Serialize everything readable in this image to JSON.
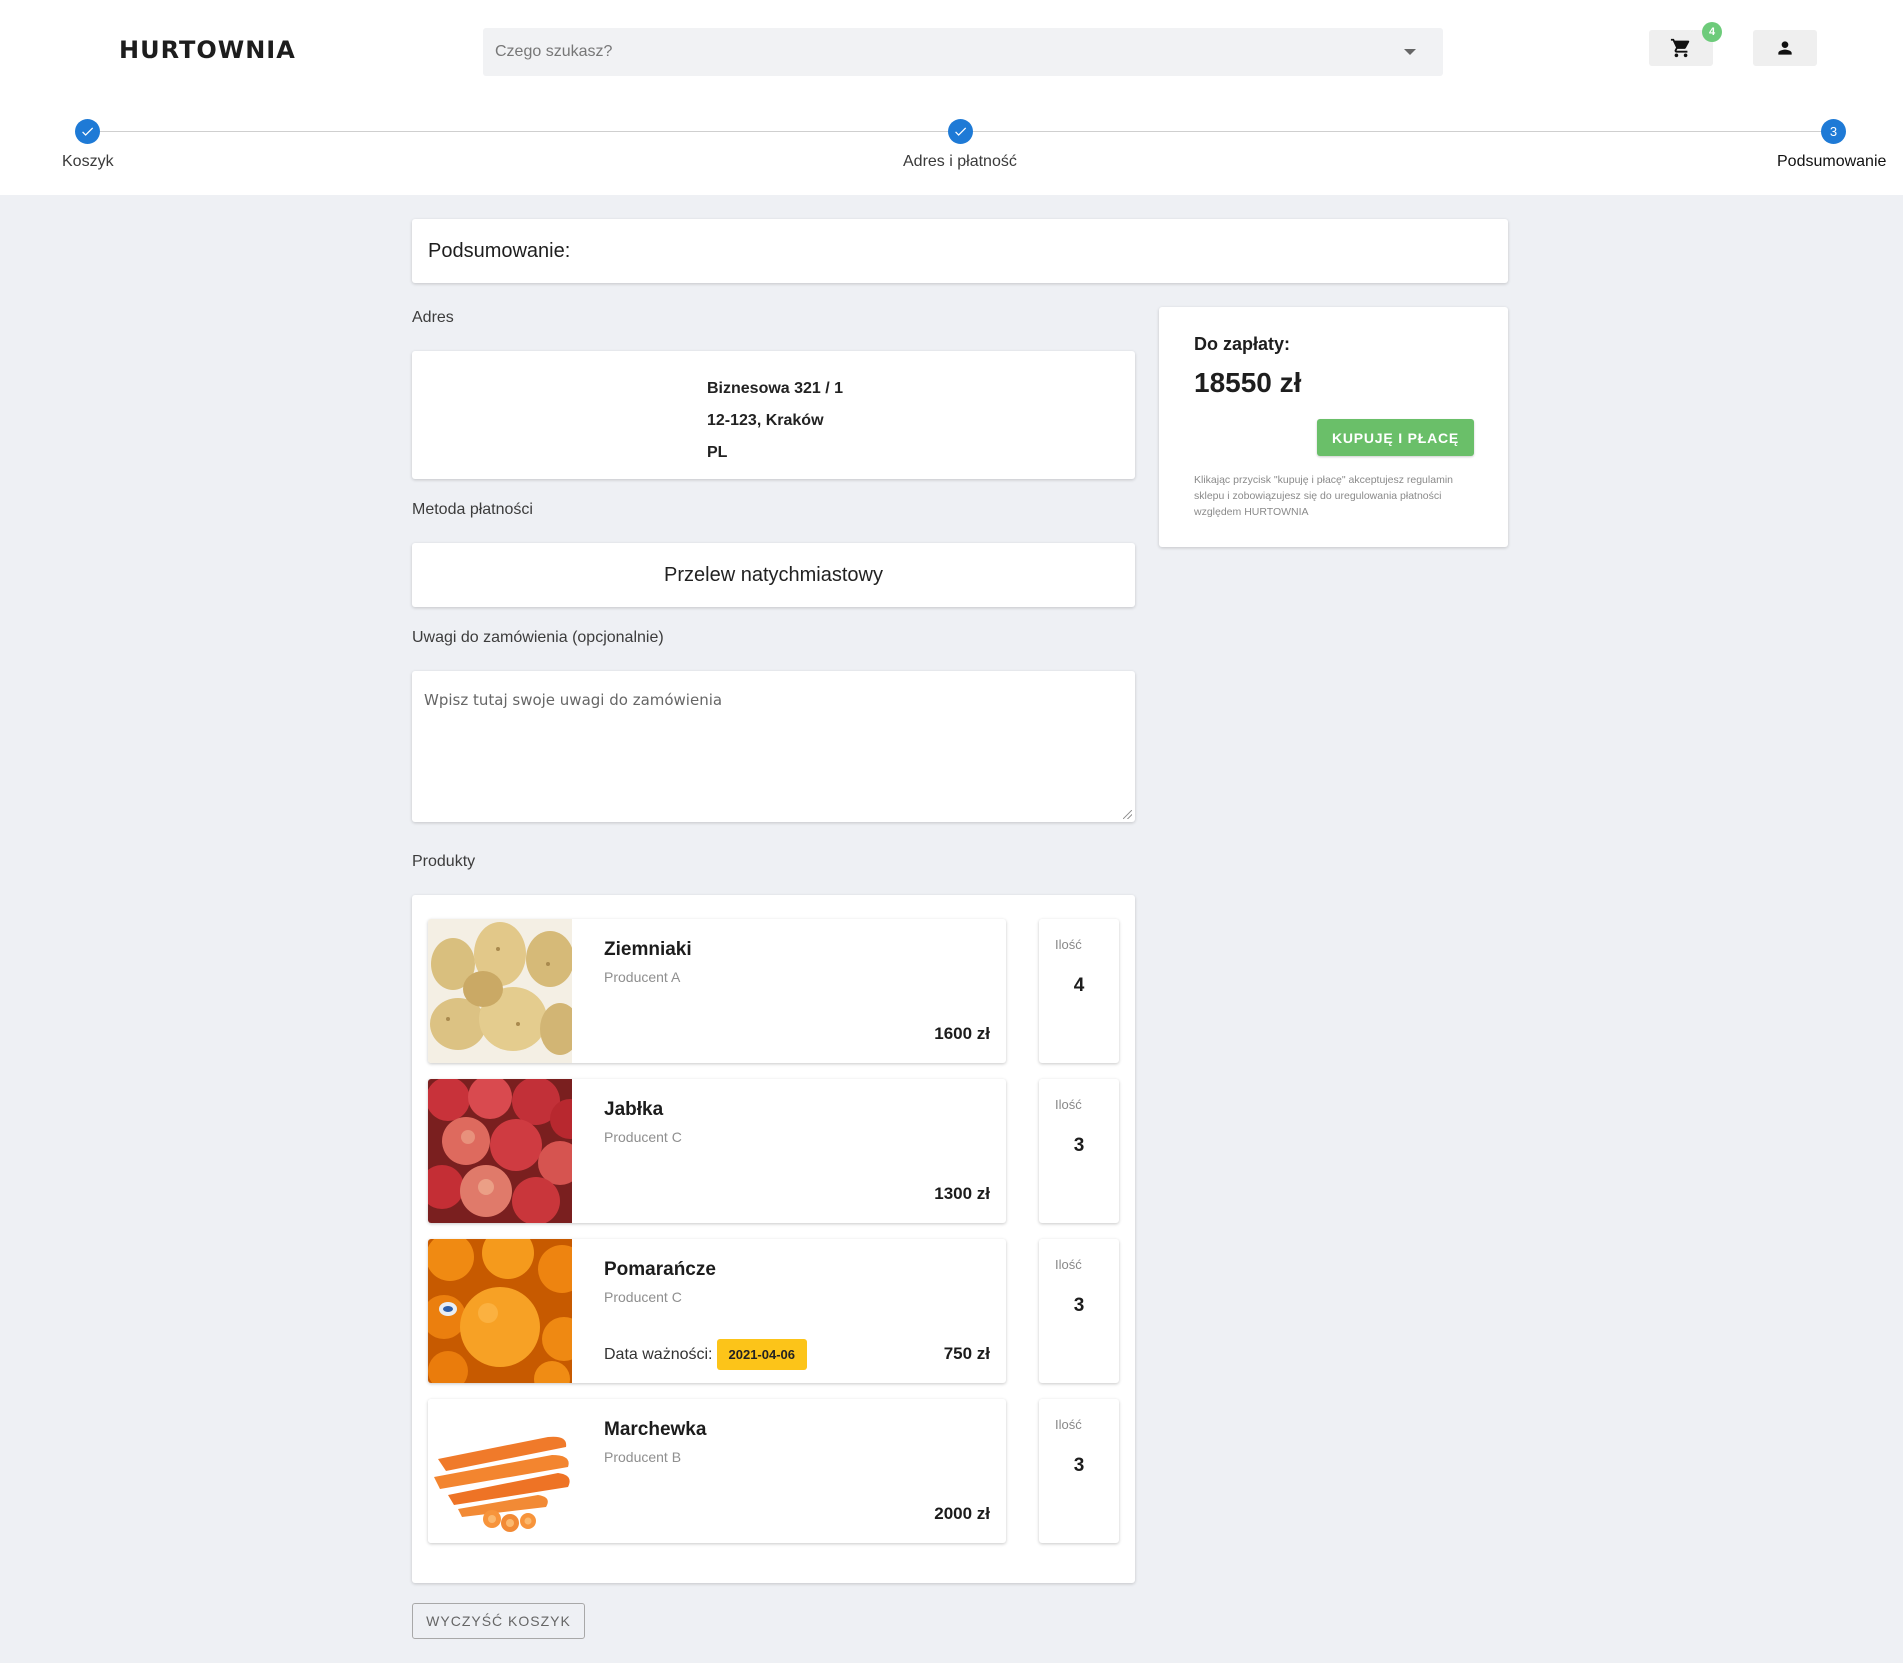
{
  "header": {
    "logo": "HURTOWNIA",
    "search_placeholder": "Czego szukasz?",
    "cart_count": "4",
    "icons": {
      "cart": "cart-icon",
      "user": "user-icon",
      "dropdown": "chevron-down-icon"
    }
  },
  "stepper": {
    "steps": [
      {
        "label": "Koszyk",
        "state": "done"
      },
      {
        "label": "Adres i płatność",
        "state": "done"
      },
      {
        "label": "Podsumowanie",
        "number": "3",
        "state": "active"
      }
    ]
  },
  "summary": {
    "title": "Podsumowanie:",
    "address_label": "Adres",
    "address": {
      "line1": "Biznesowa 321 / 1",
      "line2": "12-123, Kraków",
      "line3": "PL"
    },
    "payment_label": "Metoda płatności",
    "payment_method": "Przelew natychmiastowy",
    "notes_label": "Uwagi do zamówienia (opcjonalnie)",
    "notes_placeholder": "Wpisz tutaj swoje uwagi do zamówienia",
    "notes_value": "",
    "products_label": "Produkty"
  },
  "products": [
    {
      "name": "Ziemniaki",
      "producer": "Producent A",
      "price": "1600 zł",
      "qty_label": "Ilość",
      "qty": "4"
    },
    {
      "name": "Jabłka",
      "producer": "Producent C",
      "price": "1300 zł",
      "qty_label": "Ilość",
      "qty": "3"
    },
    {
      "name": "Pomarańcze",
      "producer": "Producent C",
      "price": "750 zł",
      "expiry_label": "Data ważności:",
      "expiry": "2021-04-06",
      "qty_label": "Ilość",
      "qty": "3"
    },
    {
      "name": "Marchewka",
      "producer": "Producent B",
      "price": "2000 zł",
      "qty_label": "Ilość",
      "qty": "3"
    }
  ],
  "clear_cart_label": "WYCZYŚĆ KOSZYK",
  "payment_box": {
    "label": "Do zapłaty:",
    "amount": "18550 zł",
    "buy_button": "KUPUJĘ I PŁACĘ",
    "note": "Klikając przycisk \"kupuję i płacę\" akceptujesz regulamin sklepu i zobowiązujesz się do uregulowania płatności względem HURTOWNIA"
  },
  "colors": {
    "accent_blue": "#1e7ad6",
    "buy_green": "#6abf69",
    "badge_green": "#6dcb7a",
    "expiry_yellow": "#fcc419",
    "page_bg": "#eef0f4"
  }
}
